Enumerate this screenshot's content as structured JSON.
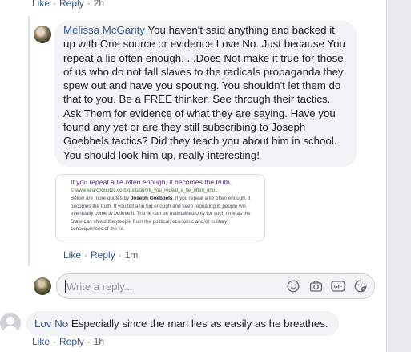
{
  "top_actions": {
    "like": "Like",
    "reply": "Reply",
    "time": "2h"
  },
  "melissa_comment": {
    "author": "Melissa McGarity",
    "text": "You haven't said anything and backed it up with One source or evidence Love No. Just because You repeat a lie often enough. . .Does Not make it true for those of us who do not fall slaves to the radicals propaganda they spew out and have you spouting. You shouldn't let them do that to you. Be a FREE thinker. See through their tactics. Ask Them for evidence of what they are saying. Have you found any yet or are they still subscribing to Joseph Goebbels tactics? Did they teach you about him in school. You should look him up, really interesting!",
    "like": "Like",
    "reply": "Reply",
    "time": "1m"
  },
  "shared_card": {
    "title": "If you repeat a lie often enough, it becomes the truth.",
    "url": "© www.searchquotes.com/quotation/If_you_repeat_a_lie_often_eno...",
    "text_intro": "Below are more quotes by ",
    "text_name": "Joseph Goebbels",
    "text_rest": ". If you repeat a lie often enough, it becomes the truth. If you tell a lie big enough and keep repeating it, people will eventually come to believe it. The lie can be maintained only for such time as the State can shield the people from the political, economic and/or military consequences of the lie."
  },
  "reply_box": {
    "placeholder": "Write a reply..."
  },
  "lov_comment": {
    "author": "Lov No",
    "text": "Especially since the man lies as easily as he breathes.",
    "like": "Like",
    "reply": "Reply",
    "time": "1h"
  },
  "colors": {
    "link": "#385898",
    "bubble": "#f2f3f5",
    "meta": "#606770"
  }
}
